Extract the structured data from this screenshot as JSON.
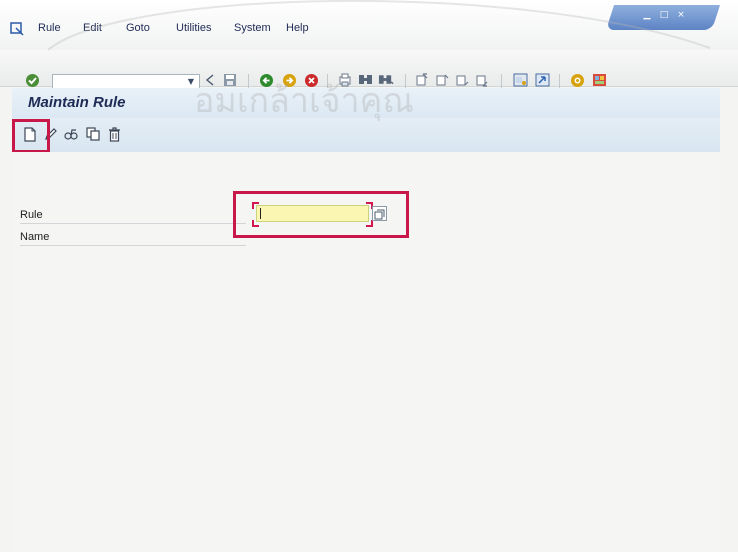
{
  "menu": {
    "items": [
      "Rule",
      "Edit",
      "Goto",
      "Utilities",
      "System",
      "Help"
    ]
  },
  "screen": {
    "title": "Maintain Rule"
  },
  "form": {
    "rule_label": "Rule",
    "rule_value": "",
    "name_label": "Name",
    "name_value": ""
  },
  "watermark": {
    "text": "อมเกล้าเจ้าคุณ"
  },
  "colors": {
    "accent": "#c8184a",
    "title_blue": "#1e2b55",
    "input_bg": "#fbf7b3"
  },
  "icons": {
    "menu": "menu-icon",
    "toolbar": [
      "enter-icon",
      "back-icon",
      "exit-icon",
      "cancel-icon"
    ],
    "application": [
      "create-icon",
      "change-icon",
      "display-icon",
      "copy-icon",
      "delete-icon"
    ]
  }
}
